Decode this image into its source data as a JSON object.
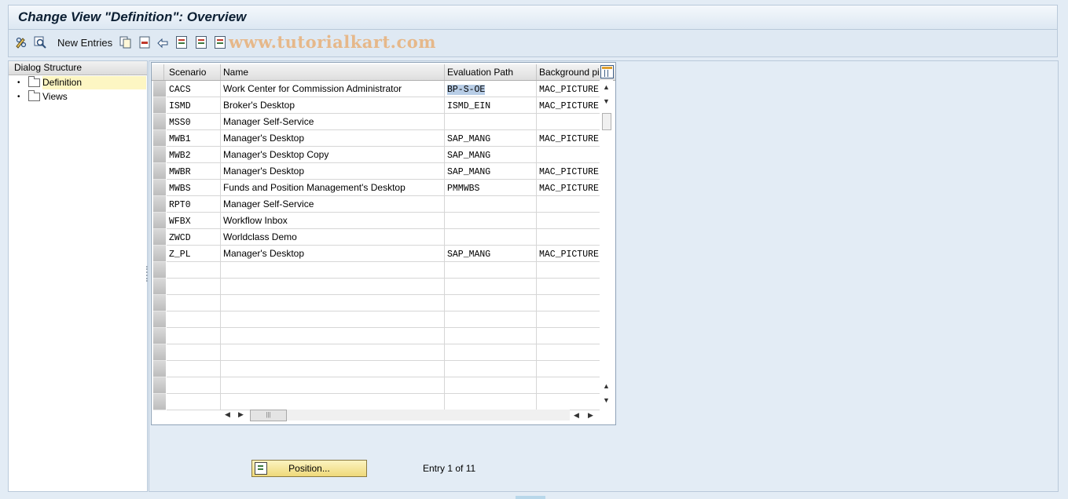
{
  "window": {
    "title": "Change View \"Definition\": Overview"
  },
  "toolbar": {
    "new_entries_label": "New Entries",
    "watermark": "www.tutorialkart.com",
    "icons": [
      "pencil-glasses-icon",
      "find-icon",
      "copy-icon",
      "delete-icon",
      "undo-icon",
      "select-all-icon",
      "select-block-icon",
      "deselect-all-icon"
    ]
  },
  "dialog_structure": {
    "header": "Dialog Structure",
    "items": [
      {
        "label": "Definition",
        "selected": true
      },
      {
        "label": "Views",
        "selected": false
      }
    ]
  },
  "table": {
    "columns": [
      "Scenario",
      "Name",
      "Evaluation Path",
      "Background pi"
    ],
    "rows": [
      {
        "scenario": "CACS",
        "name": "Work Center for Commission Administrator",
        "eval_path": "BP-S-OE",
        "background": "MAC_PICTURE"
      },
      {
        "scenario": "ISMD",
        "name": "Broker's Desktop",
        "eval_path": "ISMD_EIN",
        "background": "MAC_PICTURE"
      },
      {
        "scenario": "MSS0",
        "name": "Manager Self-Service",
        "eval_path": "",
        "background": ""
      },
      {
        "scenario": "MWB1",
        "name": "Manager's Desktop",
        "eval_path": "SAP_MANG",
        "background": "MAC_PICTURE"
      },
      {
        "scenario": "MWB2",
        "name": "Manager's Desktop Copy",
        "eval_path": "SAP_MANG",
        "background": ""
      },
      {
        "scenario": "MWBR",
        "name": "Manager's Desktop",
        "eval_path": "SAP_MANG",
        "background": "MAC_PICTURE"
      },
      {
        "scenario": "MWBS",
        "name": "Funds and Position Management's Desktop",
        "eval_path": "PMMWBS",
        "background": "MAC_PICTURE"
      },
      {
        "scenario": "RPT0",
        "name": "Manager Self-Service",
        "eval_path": "",
        "background": ""
      },
      {
        "scenario": "WFBX",
        "name": "Workflow Inbox",
        "eval_path": "",
        "background": ""
      },
      {
        "scenario": "ZWCD",
        "name": "Worldclass Demo",
        "eval_path": "",
        "background": ""
      },
      {
        "scenario": "Z_PL",
        "name": "Manager's Desktop",
        "eval_path": "SAP_MANG",
        "background": "MAC_PICTURE"
      }
    ],
    "empty_rows": 9,
    "highlighted_cell": "BP-S-OE"
  },
  "footer": {
    "position_label": "Position...",
    "entry_text": "Entry 1 of 11"
  }
}
